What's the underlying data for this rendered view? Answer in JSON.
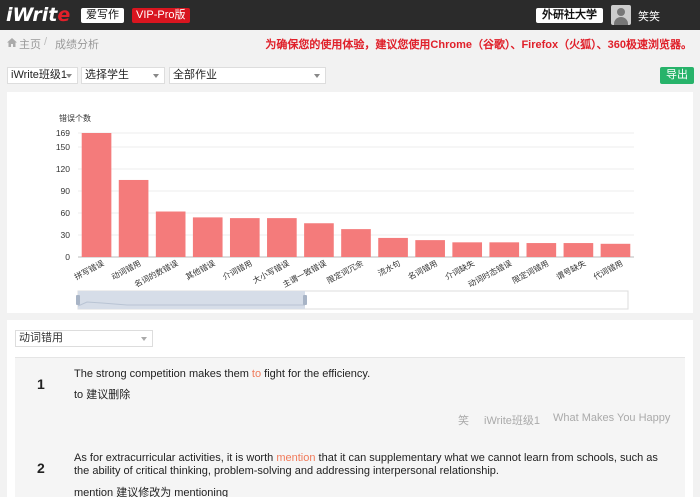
{
  "topbar": {
    "logo_main": "iWrit",
    "logo_accent": "e",
    "badge_write": "爱写作",
    "badge_vip": "VIP-Pro版",
    "university": "外研社大学",
    "username": "笑笑"
  },
  "breadcrumb": {
    "home": "主页",
    "sep": "/",
    "current": "成绩分析"
  },
  "notice": "为确保您的使用体验，建议您使用Chrome（谷歌）、Firefox（火狐）、360极速浏览器。",
  "filters": {
    "class_value": "iWrite班级1",
    "student_value": "选择学生",
    "assignment_value": "全部作业",
    "export_label": "导出"
  },
  "chart_data": {
    "type": "bar",
    "ylabel": "错误个数",
    "yticks": [
      0,
      30,
      60,
      90,
      120,
      150,
      169
    ],
    "ylim": [
      0,
      169
    ],
    "bar_color": "#f47b7b",
    "categories": [
      "拼写错误",
      "动词错用",
      "名词的数错误",
      "其他错误",
      "介词错用",
      "大小写错误",
      "主谓一致错误",
      "限定词冗余",
      "流水句",
      "名词错用",
      "介词缺失",
      "动词时态错误",
      "限定词错用",
      "谓号缺失",
      "代词错用"
    ],
    "values": [
      169,
      105,
      62,
      54,
      53,
      53,
      46,
      38,
      26,
      23,
      20,
      20,
      19,
      19,
      18
    ]
  },
  "detail": {
    "select_value": "动词错用",
    "items": [
      {
        "num": "1",
        "sentence_pre": "The strong competition makes them ",
        "sentence_hl": "to",
        "sentence_post": " fight for the efficiency.",
        "suggestion": "to 建议删除",
        "student": "笑",
        "class": "iWrite班级1",
        "assignment": "What Makes You Happy"
      },
      {
        "num": "2",
        "sentence_pre": "As for extracurricular activities, it is worth ",
        "sentence_hl": "mention",
        "sentence_post": " that it can supplementary what we cannot learn from schools, such as the ability of critical thinking, problem-solving and addressing interpersonal relationship.",
        "suggestion": "mention 建议修改为 mentioning"
      }
    ]
  }
}
